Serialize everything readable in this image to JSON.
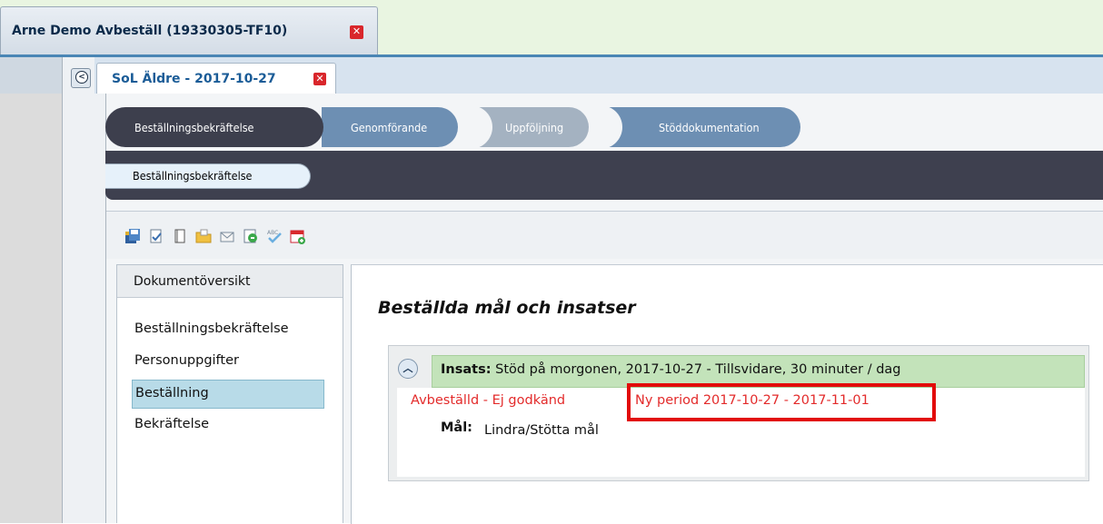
{
  "top_tab": {
    "label": "Arne Demo Avbeställ (19330305-TF10)",
    "close": "✕"
  },
  "collapse_button": "<",
  "sub_tab": {
    "label": "SoL Äldre - 2017-10-27",
    "close": "✕"
  },
  "steps": [
    "Beställningsbekräftelse",
    "Genomförande",
    "Uppföljning",
    "Stöddokumentation"
  ],
  "substeps": [
    "Beställningsbekräftelse"
  ],
  "toolbar_icons": [
    "save-icon",
    "checklist-icon",
    "document-icon",
    "folder-icon",
    "mail-icon",
    "refresh-icon",
    "spellcheck-icon",
    "calendar-icon"
  ],
  "doc_overview": {
    "title": "Dokumentöversikt",
    "items": [
      "Beställningsbekräftelse",
      "Personuppgifter",
      "Beställning",
      "Bekräftelse"
    ],
    "selected": "Beställning"
  },
  "main": {
    "title": "Beställda mål och insatser",
    "insats_label": "Insats:",
    "insats_text": "Stöd på morgonen, 2017-10-27 - Tillsvidare, 30 minuter / dag",
    "status": "Avbeställd - Ej godkänd",
    "period": "Ny period 2017-10-27 - 2017-11-01",
    "goal_label": "Mål:",
    "goal_value": "Lindra/Stötta mål"
  },
  "colors": {
    "highlight": "#e20b0b",
    "status_red": "#e32b2b",
    "insats_green": "#c3e3ba",
    "step_dark": "#3d3f4d",
    "step_blue": "#6d8fb3"
  }
}
